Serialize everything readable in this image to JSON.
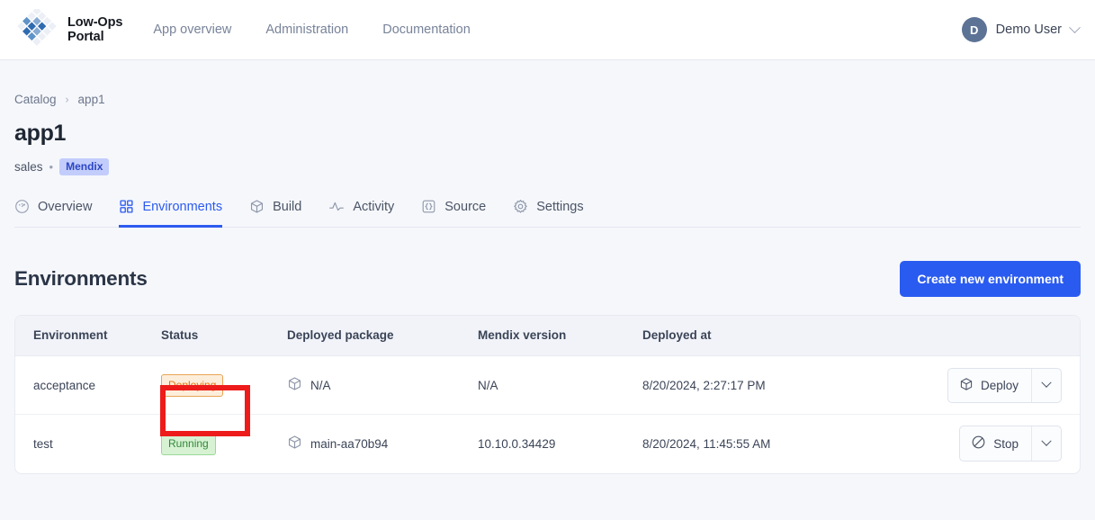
{
  "header": {
    "brand": {
      "line1": "Low-Ops",
      "line2": "Portal",
      "logo_icon": "diamond-grid-logo"
    },
    "nav": [
      {
        "label": "App overview",
        "name": "nav-app-overview"
      },
      {
        "label": "Administration",
        "name": "nav-administration"
      },
      {
        "label": "Documentation",
        "name": "nav-documentation"
      }
    ],
    "user": {
      "initial": "D",
      "name": "Demo User",
      "chevron_icon": "chevron-down-icon"
    }
  },
  "breadcrumb": {
    "root": "Catalog",
    "separator": "›",
    "current": "app1"
  },
  "title": "app1",
  "subtitle": {
    "owner": "sales",
    "dot": "•",
    "tag": "Mendix"
  },
  "tabs": [
    {
      "label": "Overview",
      "icon": "gauge-icon",
      "active": false
    },
    {
      "label": "Environments",
      "icon": "grid-squares-icon",
      "active": true
    },
    {
      "label": "Build",
      "icon": "package-box-icon",
      "active": false
    },
    {
      "label": "Activity",
      "icon": "pulse-line-icon",
      "active": false
    },
    {
      "label": "Source",
      "icon": "curly-braces-icon",
      "active": false
    },
    {
      "label": "Settings",
      "icon": "gear-icon",
      "active": false
    }
  ],
  "section": {
    "title": "Environments",
    "create_button": "Create new environment"
  },
  "table": {
    "columns": [
      "Environment",
      "Status",
      "Deployed package",
      "Mendix version",
      "Deployed at",
      ""
    ],
    "rows": [
      {
        "environment": "acceptance",
        "status": "Deploying",
        "status_kind": "deploying",
        "package": "N/A",
        "package_icon": "package-box-icon",
        "version": "N/A",
        "deployed_at": "8/20/2024, 2:27:17 PM",
        "action_label": "Deploy",
        "action_icon": "package-box-icon"
      },
      {
        "environment": "test",
        "status": "Running",
        "status_kind": "running",
        "package": "main-aa70b94",
        "package_icon": "package-box-icon",
        "version": "10.10.0.34429",
        "deployed_at": "8/20/2024, 11:45:55 AM",
        "action_label": "Stop",
        "action_icon": "stop-circle-slash-icon"
      }
    ]
  },
  "annotation": {
    "color": "#ee1b1b",
    "target": "status-badge-deploying"
  },
  "colors": {
    "accent": "#2a5bf0",
    "page_bg": "#f5f7fb",
    "deploying_text": "#e2760f",
    "deploying_bg": "#fdeedb",
    "running_text": "#34873a",
    "running_bg": "#d6f2d3",
    "tag_bg": "#c3cdfb",
    "tag_text": "#2b46c4",
    "avatar_bg": "#5c7396"
  }
}
